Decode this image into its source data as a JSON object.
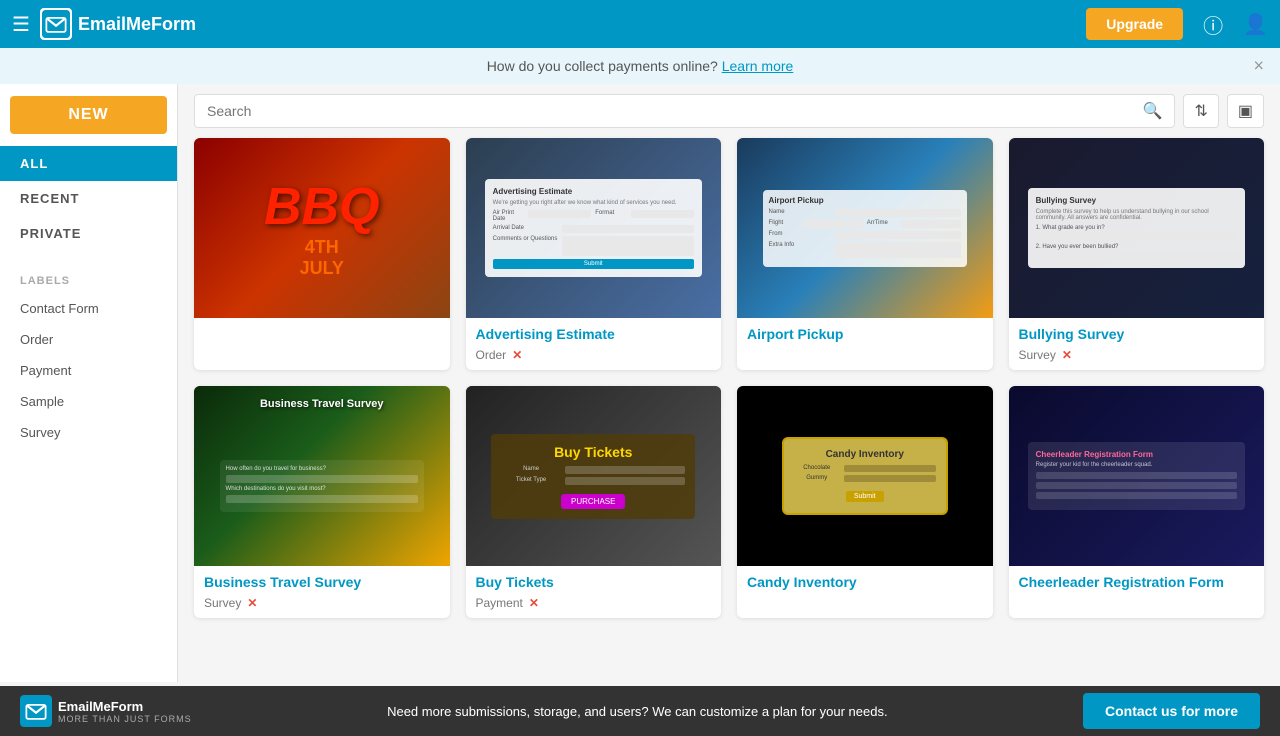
{
  "topbar": {
    "logo_text": "EmailMeForm",
    "upgrade_label": "Upgrade"
  },
  "banner": {
    "text": "How do you collect payments online?",
    "link_text": "Learn more"
  },
  "sidebar": {
    "new_label": "NEW",
    "nav": [
      {
        "id": "all",
        "label": "ALL",
        "active": true
      },
      {
        "id": "recent",
        "label": "RECENT",
        "active": false
      },
      {
        "id": "private",
        "label": "PRIVATE",
        "active": false
      }
    ],
    "labels_title": "LABELS",
    "labels": [
      {
        "id": "contact-form",
        "label": "Contact Form"
      },
      {
        "id": "order",
        "label": "Order"
      },
      {
        "id": "payment",
        "label": "Payment"
      },
      {
        "id": "sample",
        "label": "Sample"
      },
      {
        "id": "survey",
        "label": "Survey"
      }
    ]
  },
  "toolbar": {
    "search_placeholder": "Search",
    "view_sort_icon": "⇅",
    "view_grid_icon": "▦"
  },
  "forms": [
    {
      "id": "bbq",
      "title": "",
      "thumb_type": "bbq",
      "tags": []
    },
    {
      "id": "advertising-estimate",
      "title": "Advertising Estimate",
      "thumb_type": "adv",
      "tags": [
        {
          "label": "Order",
          "removable": true
        }
      ]
    },
    {
      "id": "airport-pickup",
      "title": "Airport Pickup",
      "thumb_type": "airport",
      "tags": []
    },
    {
      "id": "bullying-survey",
      "title": "Bullying Survey",
      "thumb_type": "bullying",
      "tags": [
        {
          "label": "Survey",
          "removable": true
        }
      ]
    },
    {
      "id": "business-travel-survey",
      "title": "Business Travel Survey",
      "thumb_type": "travel",
      "tags": [
        {
          "label": "Survey",
          "removable": true
        }
      ]
    },
    {
      "id": "buy-tickets",
      "title": "Buy Tickets",
      "thumb_type": "tickets",
      "tags": [
        {
          "label": "Payment",
          "removable": true
        }
      ]
    },
    {
      "id": "candy-inventory",
      "title": "Candy Inventory",
      "thumb_type": "candy",
      "tags": []
    },
    {
      "id": "cheerleader-registration",
      "title": "Cheerleader Registration Form",
      "thumb_type": "cheer",
      "tags": []
    }
  ],
  "bottom_bar": {
    "logo_text": "EmailMeForm",
    "logo_sub": "MORE THAN JUST FORMS",
    "message": "Need more submissions, storage, and users? We can customize a plan for your needs.",
    "contact_label": "Contact us for more"
  }
}
